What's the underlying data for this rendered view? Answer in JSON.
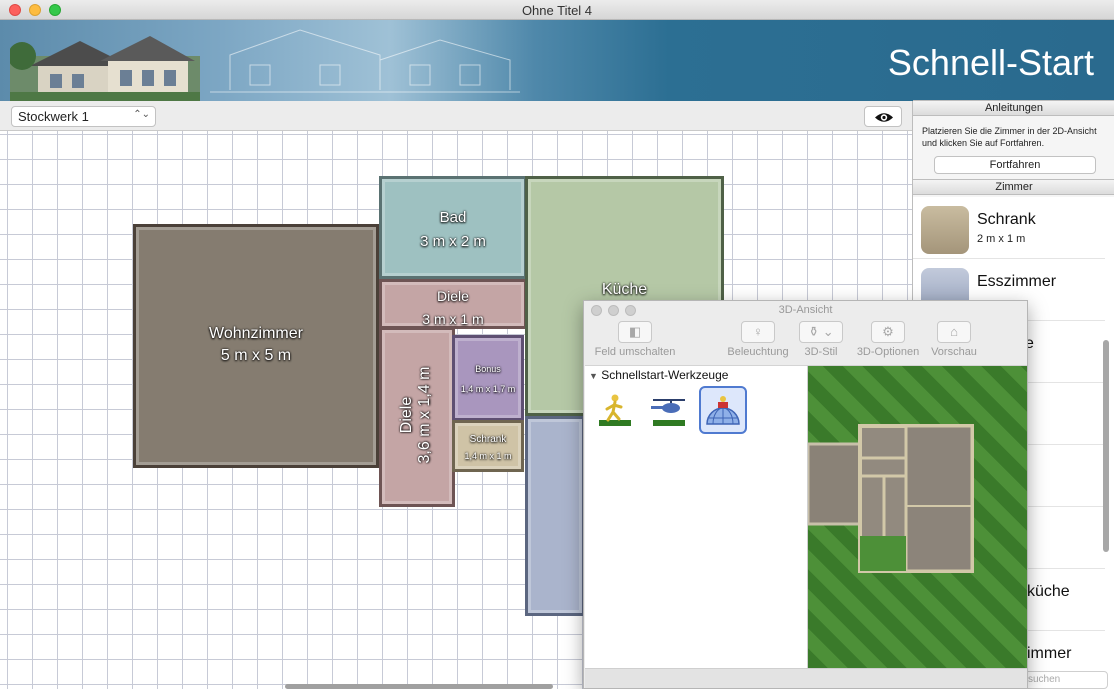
{
  "window": {
    "title": "Ohne Titel 4"
  },
  "banner": {
    "heading": "Schnell-Start"
  },
  "floor_select": {
    "value": "Stockwerk 1",
    "chevron_icon": "chevron-updown-icon"
  },
  "view_toggle": {
    "icon": "eye-icon"
  },
  "floorplan": {
    "rooms": [
      {
        "name": "Wohnzimmer",
        "size": "5 m x 5 m"
      },
      {
        "name": "Bad",
        "size": "3 m x 2 m"
      },
      {
        "name": "Diele",
        "size": "3 m x 1 m"
      },
      {
        "name": "Küche",
        "size": ""
      },
      {
        "name": "Diele",
        "size": "3,6 m x 1,4 m"
      },
      {
        "name": "Bonus",
        "size": "1,4 m x 1,7 m"
      },
      {
        "name": "Schrank",
        "size": "1,4 m x 1 m"
      }
    ]
  },
  "panel": {
    "instructions_header": "Anleitungen",
    "instructions_text": "Platzieren Sie die Zimmer in der 2D-Ansicht und klicken Sie auf Fortfahren.",
    "continue_label": "Fortfahren",
    "rooms_header": "Zimmer",
    "room_items": [
      {
        "name": "Schrank",
        "size": "2 m x 1 m",
        "color": "#b8a98c"
      },
      {
        "name": "Esszimmer",
        "size": "",
        "color": "#aab4cc"
      },
      {
        "name": "e",
        "size": "",
        "color": ""
      },
      {
        "name": "n",
        "size": "",
        "color": ""
      },
      {
        "name": "küche",
        "size": "",
        "color": ""
      },
      {
        "name": "immer",
        "size": "",
        "color": ""
      }
    ],
    "search_placeholder": "suchen"
  },
  "view3d": {
    "title": "3D-Ansicht",
    "toolbar": [
      {
        "label": "Feld umschalten",
        "icon": "panel-toggle-icon"
      },
      {
        "label": "Beleuchtung",
        "icon": "lightbulb-icon"
      },
      {
        "label": "3D-Stil",
        "icon": "paintbrush-icon"
      },
      {
        "label": "3D-Optionen",
        "icon": "gear-icon"
      },
      {
        "label": "Vorschau",
        "icon": "house-icon"
      }
    ],
    "tools_header": "Schnellstart-Werkzeuge",
    "tools": [
      {
        "name": "walk",
        "icon": "walking-person-icon"
      },
      {
        "name": "fly",
        "icon": "helicopter-icon"
      },
      {
        "name": "dome",
        "icon": "dome-view-icon"
      }
    ]
  },
  "colors": {
    "banner_blue": "#2a6a8e",
    "wohnzimmer": "#857c70",
    "bad": "#9ec1c1",
    "diele": "#c4a5a5",
    "kueche": "#b5c8a6",
    "bonus": "#a996be",
    "schrank": "#cfc3a6",
    "selection_blue": "#4f7ad0"
  }
}
